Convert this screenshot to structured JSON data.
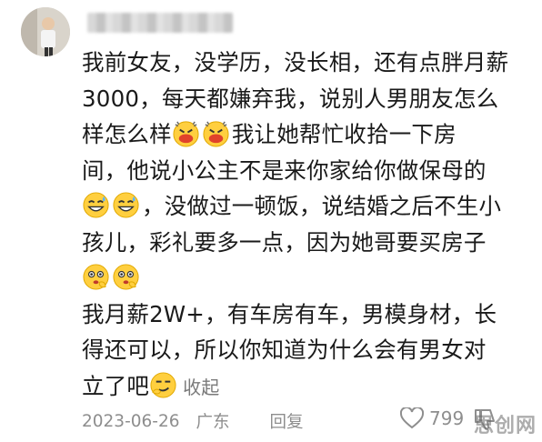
{
  "comment": {
    "username": "",
    "lines": [
      "我前女友，没学历，没长相，还有点胖月薪",
      "3000，每天都嫌弃我，说别人男朋友怎么",
      "样怎么样",
      "我让她帮忙收拾一下房",
      "间，他说小公主不是来你家给你做保母的",
      "，没做过一顿饭，说结婚之后不生小",
      "孩儿，彩礼要多一点，因为她哥要买房子",
      "我月薪2W+，有车房有车，男模身材，长",
      "得还可以，所以你知道为什么会有男女对",
      "立了吧"
    ],
    "collapse_label": "收起",
    "date": "2023-06-26",
    "location": "广东",
    "reply_label": "回复",
    "like_count": "799"
  },
  "icons": {
    "emoji_1": "angry-huff-emoji",
    "emoji_2": "grin-sweat-emoji",
    "emoji_3": "thinking-emoji",
    "emoji_4": "smug-emoji",
    "like": "heart-outline-icon",
    "dislike": "thumbs-down-icon"
  },
  "colors": {
    "text": "#1a1a1a",
    "meta": "#8e8e8e",
    "emoji_yellow": "#ffcf3f"
  },
  "watermark": "思创网"
}
